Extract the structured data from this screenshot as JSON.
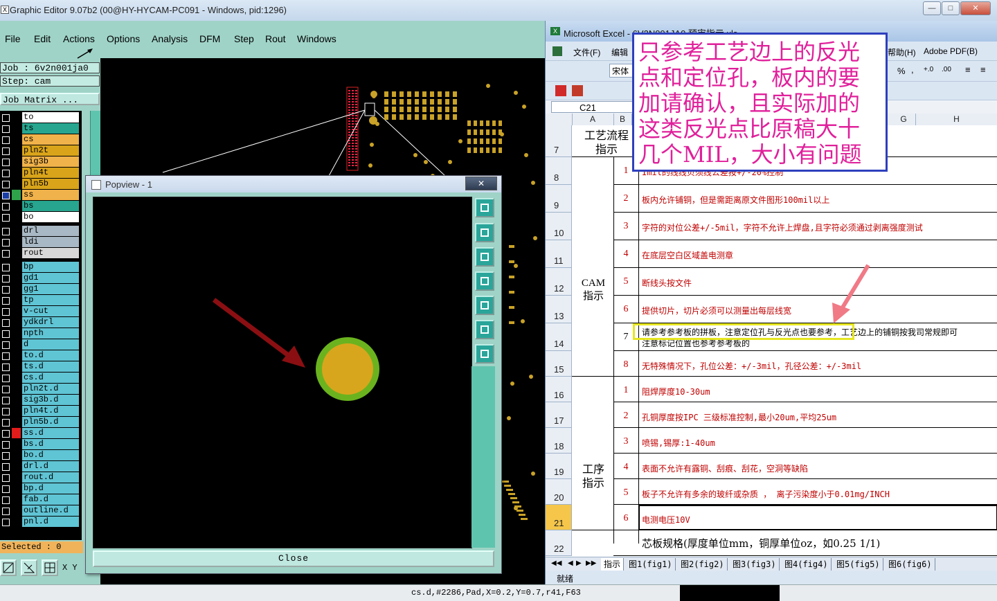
{
  "main_window": {
    "title": "Graphic Editor 9.07b2 (00@HY-HYCAM-PC091 - Windows, pid:1296)",
    "menu": [
      "File",
      "Edit",
      "Actions",
      "Options",
      "Analysis",
      "DFM",
      "Step",
      "Rout",
      "Windows"
    ],
    "job": "Job : 6v2n001ja0",
    "step": "Step: cam",
    "job_matrix": "Job Matrix ...",
    "layers": [
      {
        "name": "to",
        "color": "#ffffff"
      },
      {
        "name": "ts",
        "color": "#27a58f"
      },
      {
        "name": "cs",
        "color": "#f0b24a"
      },
      {
        "name": "pln2t",
        "color": "#d9a41a"
      },
      {
        "name": "sig3b",
        "color": "#f0b24a"
      },
      {
        "name": "pln4t",
        "color": "#d9a41a"
      },
      {
        "name": "pln5b",
        "color": "#d9a41a"
      },
      {
        "name": "ss",
        "color": "#f0b24a"
      },
      {
        "name": "bs",
        "color": "#27a58f"
      },
      {
        "name": "bo",
        "color": "#ffffff"
      },
      {
        "name": "drl",
        "color": "#a8b8c4"
      },
      {
        "name": "ldi",
        "color": "#a8b8c4"
      },
      {
        "name": "rout",
        "color": "#d8d8d8"
      },
      {
        "name": "bp",
        "color": "#5fc4d4"
      },
      {
        "name": "gd1",
        "color": "#5fc4d4"
      },
      {
        "name": "gg1",
        "color": "#5fc4d4"
      },
      {
        "name": "tp",
        "color": "#5fc4d4"
      },
      {
        "name": "v-cut",
        "color": "#5fc4d4"
      },
      {
        "name": "ydkdrl",
        "color": "#5fc4d4"
      },
      {
        "name": "npth",
        "color": "#5fc4d4"
      },
      {
        "name": "d",
        "color": "#5fc4d4"
      },
      {
        "name": "to.d",
        "color": "#5fc4d4"
      },
      {
        "name": "ts.d",
        "color": "#5fc4d4"
      },
      {
        "name": "cs.d",
        "color": "#5fc4d4"
      },
      {
        "name": "pln2t.d",
        "color": "#5fc4d4"
      },
      {
        "name": "sig3b.d",
        "color": "#5fc4d4"
      },
      {
        "name": "pln4t.d",
        "color": "#5fc4d4"
      },
      {
        "name": "pln5b.d",
        "color": "#5fc4d4"
      },
      {
        "name": "ss.d",
        "color": "#5fc4d4"
      },
      {
        "name": "bs.d",
        "color": "#5fc4d4"
      },
      {
        "name": "bo.d",
        "color": "#5fc4d4"
      },
      {
        "name": "drl.d",
        "color": "#5fc4d4"
      },
      {
        "name": "rout.d",
        "color": "#5fc4d4"
      },
      {
        "name": "bp.d",
        "color": "#5fc4d4"
      },
      {
        "name": "fab.d",
        "color": "#5fc4d4"
      },
      {
        "name": "outline.d",
        "color": "#5fc4d4"
      },
      {
        "name": "pnl.d",
        "color": "#5fc4d4"
      }
    ],
    "selected": "Selected : 0",
    "xy_label": "X Y",
    "status_line": "cs.d,#2286,Pad,X=0.2,Y=0.7,r41,F63"
  },
  "popview": {
    "title": "Popview - 1",
    "close_label": "Close"
  },
  "excel": {
    "title": "Microsoft Excel - 6V2N001JA0 预审指示.xls",
    "menu": [
      "文件(F)",
      "编辑",
      "帮助(H)",
      "Adobe PDF(B)"
    ],
    "font_name": "宋体",
    "cell_ref": "C21",
    "col_headers": [
      "A",
      "B",
      "G",
      "H"
    ],
    "row7_header": "工艺流程\n指示",
    "section_cam": "CAM\n指示",
    "section_process": "工序\n指示",
    "rows": [
      {
        "row": "7",
        "num": "",
        "text": ""
      },
      {
        "row": "8",
        "num": "1",
        "text": "Imil的线线贝须线公差按+/-20%控制"
      },
      {
        "row": "9",
        "num": "2",
        "text": "板内允许铺铜，但是需距离原文件图形100mil以上"
      },
      {
        "row": "10",
        "num": "3",
        "text": "字符的对位公差+/-5mil，字符不允许上焊盘,且字符必须通过剥离强度测试"
      },
      {
        "row": "11",
        "num": "4",
        "text": "在底层空白区域盖电测章"
      },
      {
        "row": "12",
        "num": "5",
        "text": "断线头按文件"
      },
      {
        "row": "13",
        "num": "6",
        "text": "提供切片，切片必须可以测量出每层线宽"
      },
      {
        "row": "14",
        "num": "7",
        "text": "请参考参考板的拼板，注意定位孔与反光点也要参考，工艺边上的铺铜按我司常规即可",
        "text2": "注意标记位置也参考参考板的"
      },
      {
        "row": "15",
        "num": "8",
        "text": "无特殊情况下，孔位公差：+/-3mil，孔径公差：+/-3mil"
      },
      {
        "row": "16",
        "num": "1",
        "text": "阻焊厚度10-30um"
      },
      {
        "row": "17",
        "num": "2",
        "text": "孔铜厚度按IPC 三级标准控制,最小20um,平均25um"
      },
      {
        "row": "18",
        "num": "3",
        "text": "喷锡,锡厚:1-40um"
      },
      {
        "row": "19",
        "num": "4",
        "text": "表面不允许有露铜、刮痕、刮花，空洞等缺陷"
      },
      {
        "row": "20",
        "num": "5",
        "text": "板子不允许有多余的玻纤或杂质 ， 离子污染度小于0.01mg/INCH"
      },
      {
        "row": "21",
        "num": "6",
        "text": "电测电压10V"
      },
      {
        "row": "22",
        "num": "",
        "text": "芯板规格(厚度单位mm，铜厚单位oz，如0.25 1/1)"
      }
    ],
    "sheet_tabs": [
      "指示",
      "图1(fig1)",
      "图2(fig2)",
      "图3(fig3)",
      "图4(fig4)",
      "图5(fig5)",
      "图6(fig6)"
    ],
    "status": "就绪"
  },
  "annotation": {
    "text": "只参考工艺边上的反光点和定位孔，板内的要加请确认，且实际加的这类反光点比原稿大十几个MIL，大小有问题"
  },
  "colors": {
    "teal_bg": "#9fd3c7",
    "pad_outer": "#6ab31f",
    "pad_inner": "#d8a61c",
    "arrow": "#8b0f12",
    "excel_red": "#c00000",
    "annotation_text": "#e0209b",
    "annotation_border": "#2e3fbd",
    "highlight_box": "#e6e621",
    "pink_arrow": "#f07a86"
  }
}
